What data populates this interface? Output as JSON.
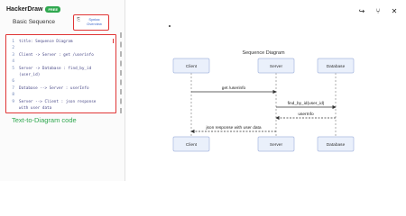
{
  "app": {
    "name": "HackerDraw",
    "badge": "FREE"
  },
  "left_panel": {
    "doc_title": "Basic Sequence",
    "overview_button": {
      "icon": "⎘",
      "label": "Syntax Overview"
    },
    "code_lines": [
      {
        "num": "1",
        "text": "title: Sequence Diagram"
      },
      {
        "num": "2",
        "text": ""
      },
      {
        "num": "3",
        "text": "Client -> Server : get /userinfo"
      },
      {
        "num": "4",
        "text": ""
      },
      {
        "num": "5",
        "text": "Server -> Database : find_by_id"
      },
      {
        "num": "",
        "text": "(user_id)"
      },
      {
        "num": "6",
        "text": ""
      },
      {
        "num": "7",
        "text": "Database --> Server : userInfo"
      },
      {
        "num": "8",
        "text": ""
      },
      {
        "num": "9",
        "text": "Server --> Client : json response"
      },
      {
        "num": "",
        "text": "with user data"
      }
    ],
    "caption": "Text-to-Diagram code"
  },
  "toolbar": {
    "export_icon": "export-icon",
    "share_icon": "share-icon",
    "close_icon": "close-icon",
    "export_glyph": "↪",
    "share_glyph": "⑂",
    "close_glyph": "✕"
  },
  "diagram": {
    "title": "Sequence Diagram",
    "participants": [
      "Client",
      "Server",
      "Database"
    ],
    "messages": [
      {
        "from": "Client",
        "to": "Server",
        "label": "get /userinfo",
        "style": "solid"
      },
      {
        "from": "Server",
        "to": "Database",
        "label": "find_by_id(user_id)",
        "style": "solid"
      },
      {
        "from": "Database",
        "to": "Server",
        "label": "userInfo",
        "style": "dashed"
      },
      {
        "from": "Server",
        "to": "Client",
        "label": "json response with user data",
        "style": "dashed"
      }
    ]
  },
  "colors": {
    "highlight_border": "#e03535",
    "caption": "#2fa84f",
    "participant_fill": "#eaf0fb",
    "participant_stroke": "#a9b9e0"
  }
}
